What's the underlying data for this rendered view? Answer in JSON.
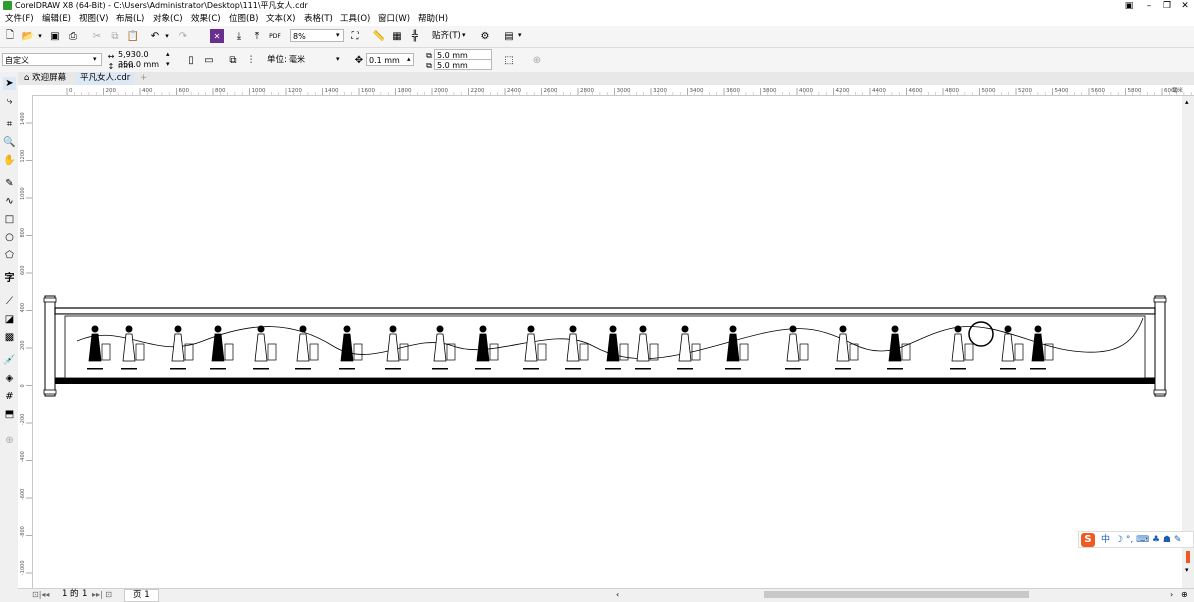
{
  "window": {
    "title": "CorelDRAW X8 (64-Bit) - C:\\Users\\Administrator\\Desktop\\111\\平凡女人.cdr"
  },
  "menu": [
    "文件(F)",
    "编辑(E)",
    "视图(V)",
    "布局(L)",
    "对象(C)",
    "效果(C)",
    "位图(B)",
    "文本(X)",
    "表格(T)",
    "工具(O)",
    "窗口(W)",
    "帮助(H)"
  ],
  "toolbar": {
    "zoom_value": "8%",
    "snap_label": "贴齐(T)"
  },
  "property_bar": {
    "page_preset": "自定义",
    "width": "5,930.0 mm",
    "height": "350.0 mm",
    "units_label": "单位:",
    "units_value": "毫米",
    "nudge": "0.1 mm",
    "dup_x": "5.0 mm",
    "dup_y": "5.0 mm"
  },
  "tabs": [
    "欢迎屏幕",
    "平凡女人.cdr"
  ],
  "ruler": {
    "h_ticks": [
      "0",
      "200",
      "400",
      "600",
      "800",
      "1000",
      "1200",
      "1400",
      "1600",
      "1800",
      "2000",
      "2200",
      "2400",
      "2600",
      "2800",
      "3000",
      "3200",
      "3400",
      "3600",
      "3800",
      "4000",
      "4200",
      "4400",
      "4600",
      "4800",
      "5000",
      "5200",
      "5400",
      "5600",
      "5800",
      "6000"
    ],
    "h_unit": "毫米",
    "v_ticks": [
      "1400",
      "1200",
      "1000",
      "800",
      "600",
      "400",
      "200",
      "0",
      "-200",
      "-400",
      "-600",
      "-800",
      "-1000"
    ]
  },
  "page_nav": {
    "current": "1",
    "of_label": "的",
    "total": "1",
    "page_tab": "页 1"
  },
  "ime": {
    "logo": "S",
    "lang": "中"
  },
  "colors": {
    "accent_green": "#2d9e2d",
    "ime_orange": "#f05a22",
    "tab_active": "#dce8f5"
  }
}
